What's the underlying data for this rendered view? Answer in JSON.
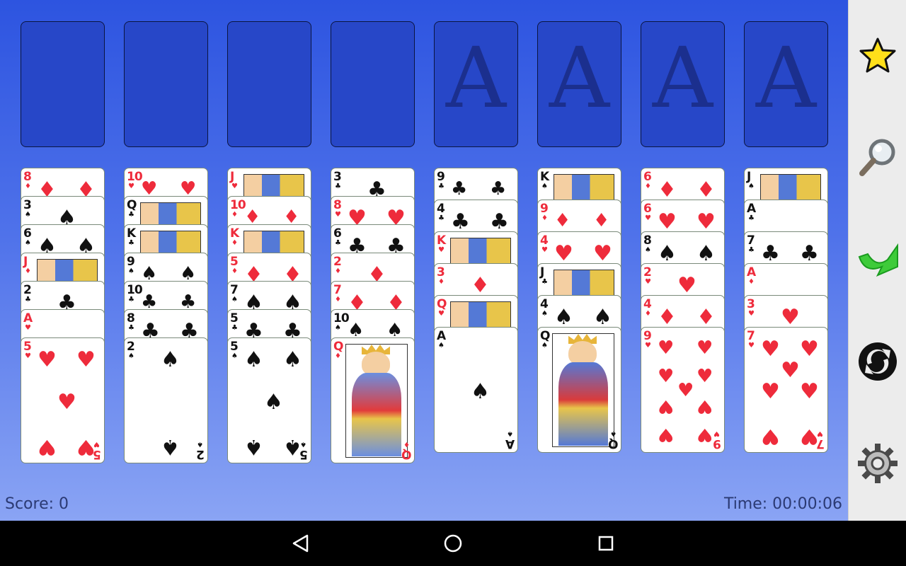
{
  "status": {
    "score_label": "Score: 0",
    "time_label": "Time: 00:00:06"
  },
  "slots": {
    "foundation_letter": "A"
  },
  "tableau": [
    [
      "8♦",
      "3♠",
      "6♠",
      "J♦",
      "2♣",
      "A♥",
      "5♥"
    ],
    [
      "10♥",
      "Q♣",
      "K♣",
      "9♠",
      "10♣",
      "8♣",
      "2♠"
    ],
    [
      "J♥",
      "10♦",
      "K♦",
      "5♦",
      "7♠",
      "5♣",
      "5♠"
    ],
    [
      "3♣",
      "8♥",
      "6♣",
      "2♦",
      "7♦",
      "10♠",
      "Q♦"
    ],
    [
      "9♣",
      "4♣",
      "K♥",
      "3♦",
      "Q♥",
      "A♠"
    ],
    [
      "K♠",
      "9♦",
      "4♥",
      "J♣",
      "4♠",
      "Q♠"
    ],
    [
      "6♦",
      "6♥",
      "8♠",
      "2♥",
      "4♦",
      "9♥"
    ],
    [
      "J♠",
      "A♣",
      "7♣",
      "A♦",
      "3♥",
      "7♥"
    ]
  ],
  "sidebar": {
    "icons": [
      "star-icon",
      "magnifier-icon",
      "hint-arrow-icon",
      "restart-icon",
      "gear-icon"
    ]
  },
  "navbar": {
    "icons": [
      "back-icon",
      "home-icon",
      "recents-icon"
    ]
  },
  "colors": {
    "red_suit": "#ee2b3b",
    "black_suit": "#111111",
    "board_top": "#2d54e0",
    "board_bottom": "#8aa4f4"
  }
}
